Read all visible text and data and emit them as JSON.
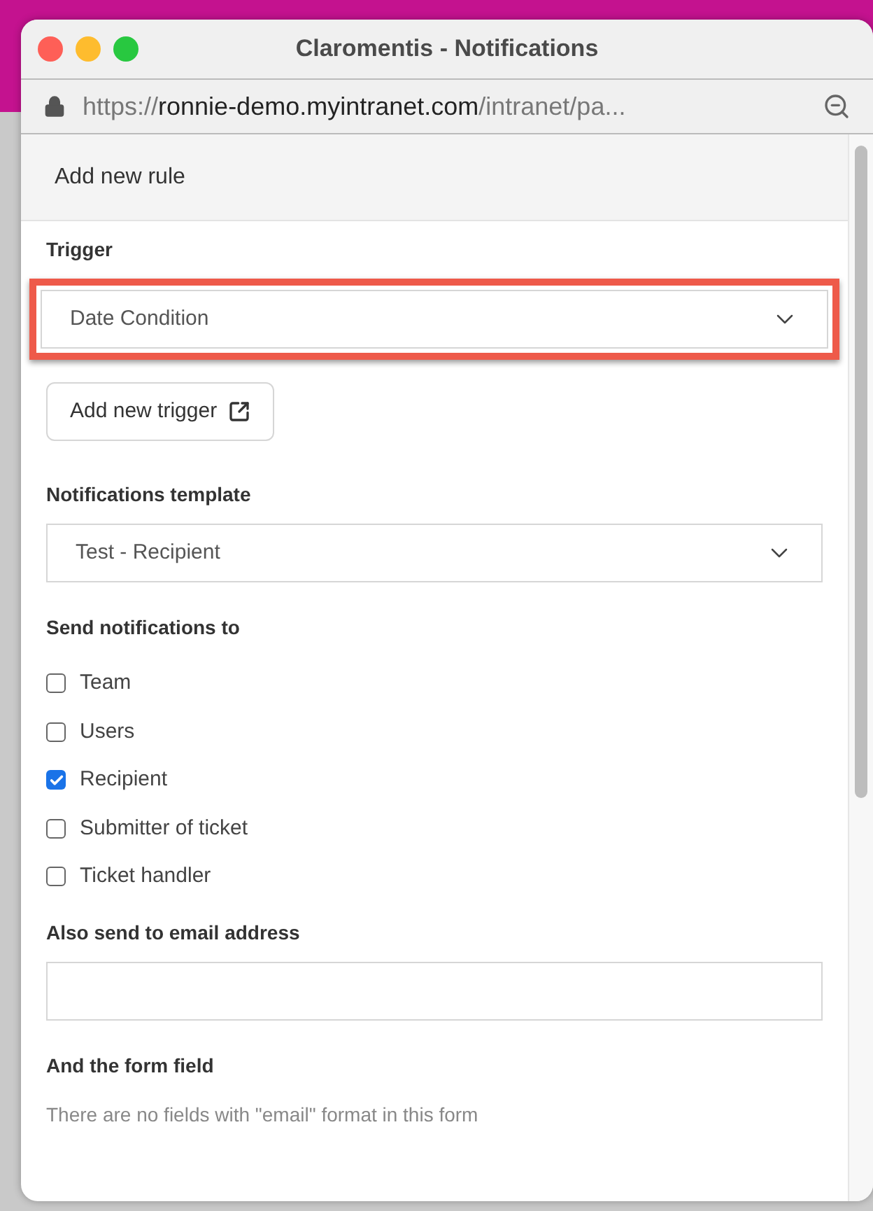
{
  "window": {
    "title": "Claromentis - Notifications"
  },
  "address_bar": {
    "scheme": "https://",
    "host": "ronnie-demo.myintranet.com",
    "path": "/intranet/pa..."
  },
  "panel": {
    "title": "Add new rule"
  },
  "trigger": {
    "label": "Trigger",
    "value": "Date Condition",
    "highlighted": true,
    "button": "Add new trigger"
  },
  "template": {
    "label": "Notifications template",
    "value": "Test - Recipient",
    "highlighted": false
  },
  "recipients": {
    "label": "Send notifications to",
    "options": [
      {
        "label": "Team",
        "checked": false
      },
      {
        "label": "Users",
        "checked": false
      },
      {
        "label": "Recipient",
        "checked": true
      },
      {
        "label": "Submitter of ticket",
        "checked": false
      },
      {
        "label": "Ticket handler",
        "checked": false
      }
    ]
  },
  "email": {
    "label": "Also send to email address"
  },
  "form_field": {
    "label": "And the form field",
    "note": "There are no fields with \"email\" format in this form"
  }
}
